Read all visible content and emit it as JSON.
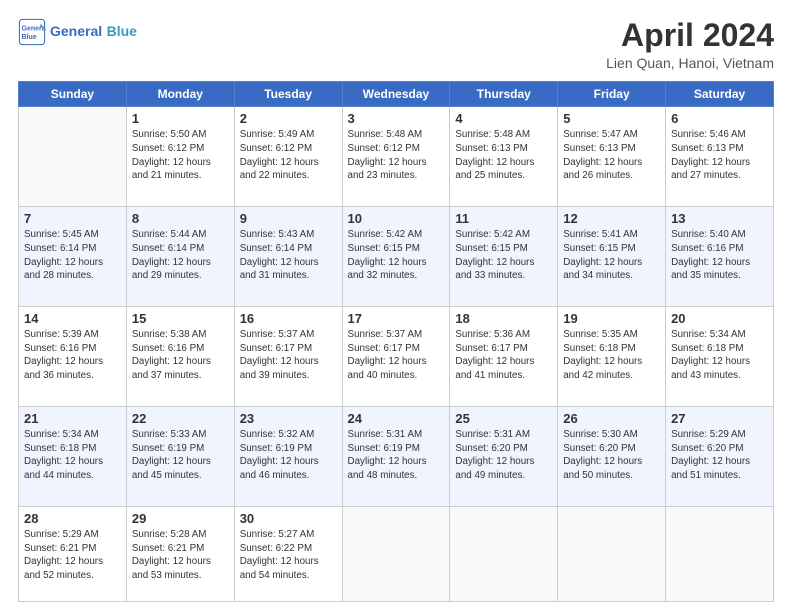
{
  "header": {
    "logo_line1": "General",
    "logo_line2": "Blue",
    "title": "April 2024",
    "location": "Lien Quan, Hanoi, Vietnam"
  },
  "weekdays": [
    "Sunday",
    "Monday",
    "Tuesday",
    "Wednesday",
    "Thursday",
    "Friday",
    "Saturday"
  ],
  "weeks": [
    [
      {
        "day": "",
        "info": ""
      },
      {
        "day": "1",
        "info": "Sunrise: 5:50 AM\nSunset: 6:12 PM\nDaylight: 12 hours\nand 21 minutes."
      },
      {
        "day": "2",
        "info": "Sunrise: 5:49 AM\nSunset: 6:12 PM\nDaylight: 12 hours\nand 22 minutes."
      },
      {
        "day": "3",
        "info": "Sunrise: 5:48 AM\nSunset: 6:12 PM\nDaylight: 12 hours\nand 23 minutes."
      },
      {
        "day": "4",
        "info": "Sunrise: 5:48 AM\nSunset: 6:13 PM\nDaylight: 12 hours\nand 25 minutes."
      },
      {
        "day": "5",
        "info": "Sunrise: 5:47 AM\nSunset: 6:13 PM\nDaylight: 12 hours\nand 26 minutes."
      },
      {
        "day": "6",
        "info": "Sunrise: 5:46 AM\nSunset: 6:13 PM\nDaylight: 12 hours\nand 27 minutes."
      }
    ],
    [
      {
        "day": "7",
        "info": "Sunrise: 5:45 AM\nSunset: 6:14 PM\nDaylight: 12 hours\nand 28 minutes."
      },
      {
        "day": "8",
        "info": "Sunrise: 5:44 AM\nSunset: 6:14 PM\nDaylight: 12 hours\nand 29 minutes."
      },
      {
        "day": "9",
        "info": "Sunrise: 5:43 AM\nSunset: 6:14 PM\nDaylight: 12 hours\nand 31 minutes."
      },
      {
        "day": "10",
        "info": "Sunrise: 5:42 AM\nSunset: 6:15 PM\nDaylight: 12 hours\nand 32 minutes."
      },
      {
        "day": "11",
        "info": "Sunrise: 5:42 AM\nSunset: 6:15 PM\nDaylight: 12 hours\nand 33 minutes."
      },
      {
        "day": "12",
        "info": "Sunrise: 5:41 AM\nSunset: 6:15 PM\nDaylight: 12 hours\nand 34 minutes."
      },
      {
        "day": "13",
        "info": "Sunrise: 5:40 AM\nSunset: 6:16 PM\nDaylight: 12 hours\nand 35 minutes."
      }
    ],
    [
      {
        "day": "14",
        "info": "Sunrise: 5:39 AM\nSunset: 6:16 PM\nDaylight: 12 hours\nand 36 minutes."
      },
      {
        "day": "15",
        "info": "Sunrise: 5:38 AM\nSunset: 6:16 PM\nDaylight: 12 hours\nand 37 minutes."
      },
      {
        "day": "16",
        "info": "Sunrise: 5:37 AM\nSunset: 6:17 PM\nDaylight: 12 hours\nand 39 minutes."
      },
      {
        "day": "17",
        "info": "Sunrise: 5:37 AM\nSunset: 6:17 PM\nDaylight: 12 hours\nand 40 minutes."
      },
      {
        "day": "18",
        "info": "Sunrise: 5:36 AM\nSunset: 6:17 PM\nDaylight: 12 hours\nand 41 minutes."
      },
      {
        "day": "19",
        "info": "Sunrise: 5:35 AM\nSunset: 6:18 PM\nDaylight: 12 hours\nand 42 minutes."
      },
      {
        "day": "20",
        "info": "Sunrise: 5:34 AM\nSunset: 6:18 PM\nDaylight: 12 hours\nand 43 minutes."
      }
    ],
    [
      {
        "day": "21",
        "info": "Sunrise: 5:34 AM\nSunset: 6:18 PM\nDaylight: 12 hours\nand 44 minutes."
      },
      {
        "day": "22",
        "info": "Sunrise: 5:33 AM\nSunset: 6:19 PM\nDaylight: 12 hours\nand 45 minutes."
      },
      {
        "day": "23",
        "info": "Sunrise: 5:32 AM\nSunset: 6:19 PM\nDaylight: 12 hours\nand 46 minutes."
      },
      {
        "day": "24",
        "info": "Sunrise: 5:31 AM\nSunset: 6:19 PM\nDaylight: 12 hours\nand 48 minutes."
      },
      {
        "day": "25",
        "info": "Sunrise: 5:31 AM\nSunset: 6:20 PM\nDaylight: 12 hours\nand 49 minutes."
      },
      {
        "day": "26",
        "info": "Sunrise: 5:30 AM\nSunset: 6:20 PM\nDaylight: 12 hours\nand 50 minutes."
      },
      {
        "day": "27",
        "info": "Sunrise: 5:29 AM\nSunset: 6:20 PM\nDaylight: 12 hours\nand 51 minutes."
      }
    ],
    [
      {
        "day": "28",
        "info": "Sunrise: 5:29 AM\nSunset: 6:21 PM\nDaylight: 12 hours\nand 52 minutes."
      },
      {
        "day": "29",
        "info": "Sunrise: 5:28 AM\nSunset: 6:21 PM\nDaylight: 12 hours\nand 53 minutes."
      },
      {
        "day": "30",
        "info": "Sunrise: 5:27 AM\nSunset: 6:22 PM\nDaylight: 12 hours\nand 54 minutes."
      },
      {
        "day": "",
        "info": ""
      },
      {
        "day": "",
        "info": ""
      },
      {
        "day": "",
        "info": ""
      },
      {
        "day": "",
        "info": ""
      }
    ]
  ]
}
